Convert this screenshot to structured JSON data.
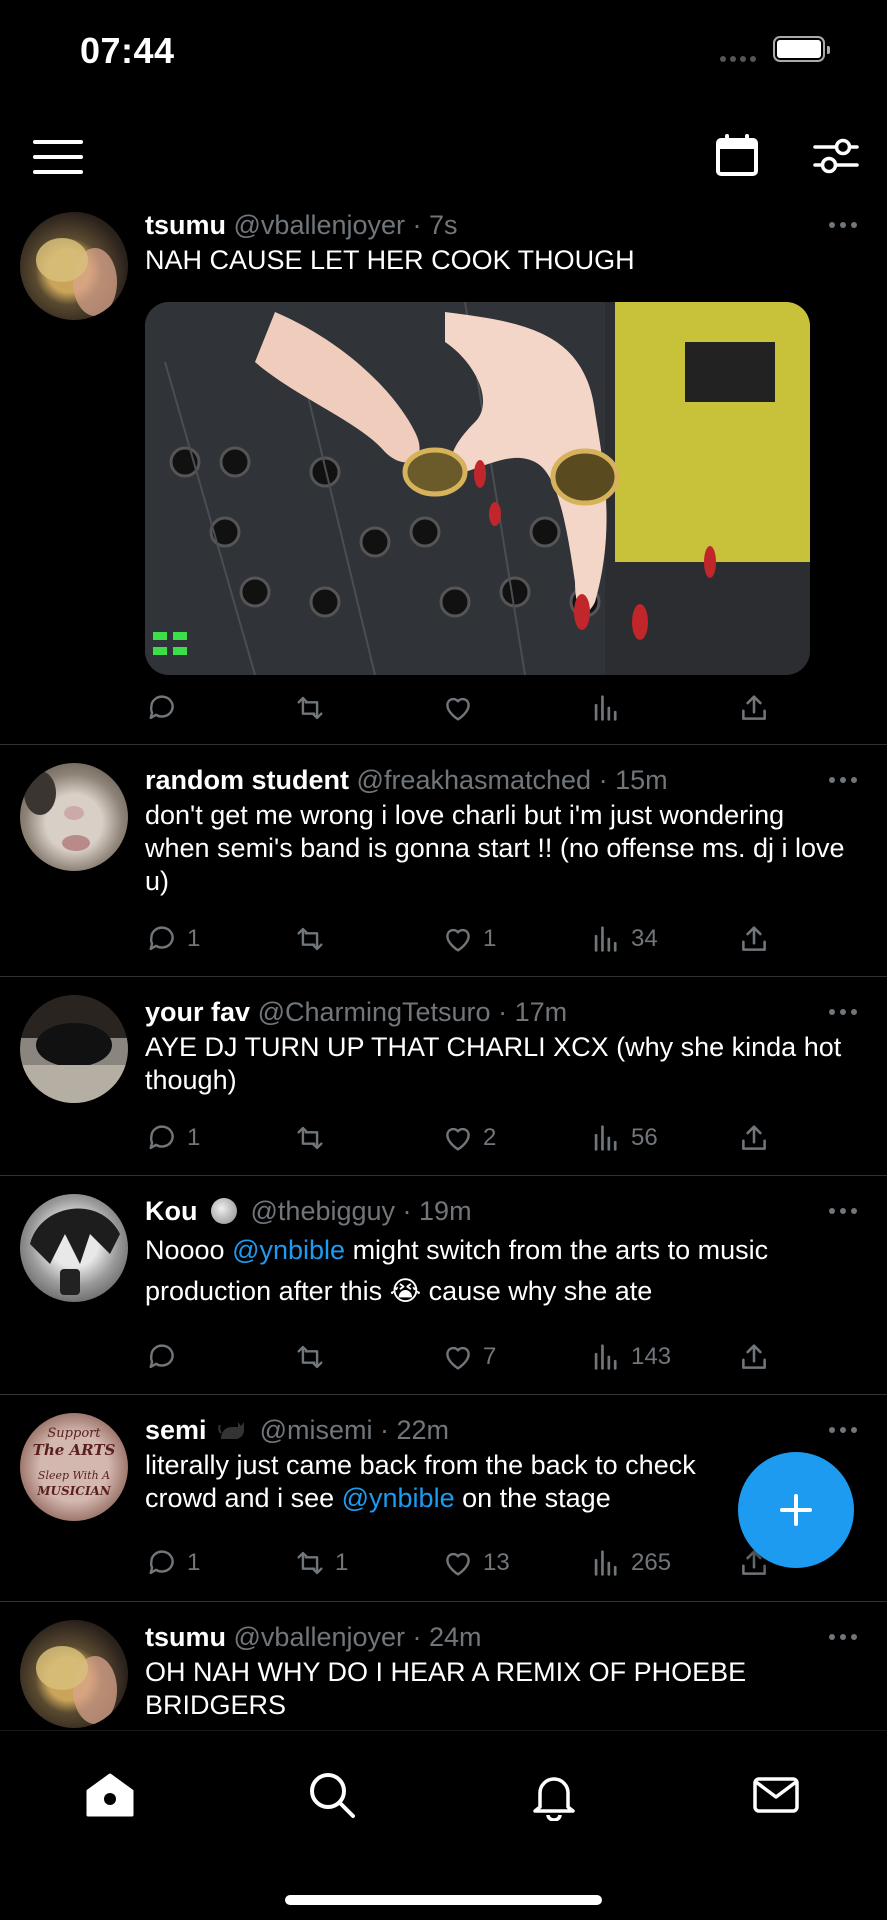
{
  "status_bar": {
    "time": "07:44"
  },
  "tweets": [
    {
      "name": "tsumu",
      "handle": "@vballenjoyer",
      "time": "· 7s",
      "text": "NAH CAUSE LET HER COOK THOUGH",
      "has_media": true,
      "replies": "",
      "retweets": "",
      "likes": "",
      "views": ""
    },
    {
      "name": "random student",
      "handle": "@freakhasmatched",
      "time": "· 15m",
      "text": "don't get me wrong i love charli but i'm just wondering when semi's band is gonna start !! (no offense ms. dj i love u)",
      "replies": "1",
      "retweets": "",
      "likes": "1",
      "views": "34"
    },
    {
      "name": "your fav",
      "handle": "@CharmingTetsuro",
      "time": "· 17m",
      "text": "AYE DJ TURN UP THAT CHARLI XCX (why she kinda hot though)",
      "replies": "1",
      "retweets": "",
      "likes": "2",
      "views": "56"
    },
    {
      "name": "Kou",
      "badge": "volleyball-icon",
      "handle": "@thebigguy",
      "time": "· 19m",
      "text_parts": [
        "Noooo ",
        "@ynbible",
        " might switch from the arts to music production after this 😭  cause why she ate"
      ],
      "replies": "",
      "retweets": "",
      "likes": "7",
      "views": "143"
    },
    {
      "name": "semi",
      "badge": "black-cat-icon",
      "handle": "@misemi",
      "time": "· 22m",
      "text_parts": [
        "literally just came back from the back to check",
        "crowd and i see ",
        "@ynbible",
        " on the stage"
      ],
      "replies": "1",
      "retweets": "1",
      "likes": "13",
      "views": "265",
      "avatar_text": [
        "Support",
        "The ARTS",
        "Sleep With A",
        "MUSICIAN"
      ]
    },
    {
      "name": "tsumu",
      "handle": "@vballenjoyer",
      "time": "· 24m",
      "text": "OH NAH WHY DO I HEAR A REMIX OF PHOEBE BRIDGERS"
    }
  ],
  "colors": {
    "accent": "#1d9bf0",
    "muted": "#71767b",
    "divider": "#2f3336",
    "background": "#000000"
  },
  "icons": [
    "menu-icon",
    "calendar-icon",
    "sliders-icon",
    "reply-icon",
    "retweet-icon",
    "like-icon",
    "views-icon",
    "share-icon",
    "compose-plus-icon",
    "home-icon",
    "search-icon",
    "bell-icon",
    "mail-icon"
  ]
}
